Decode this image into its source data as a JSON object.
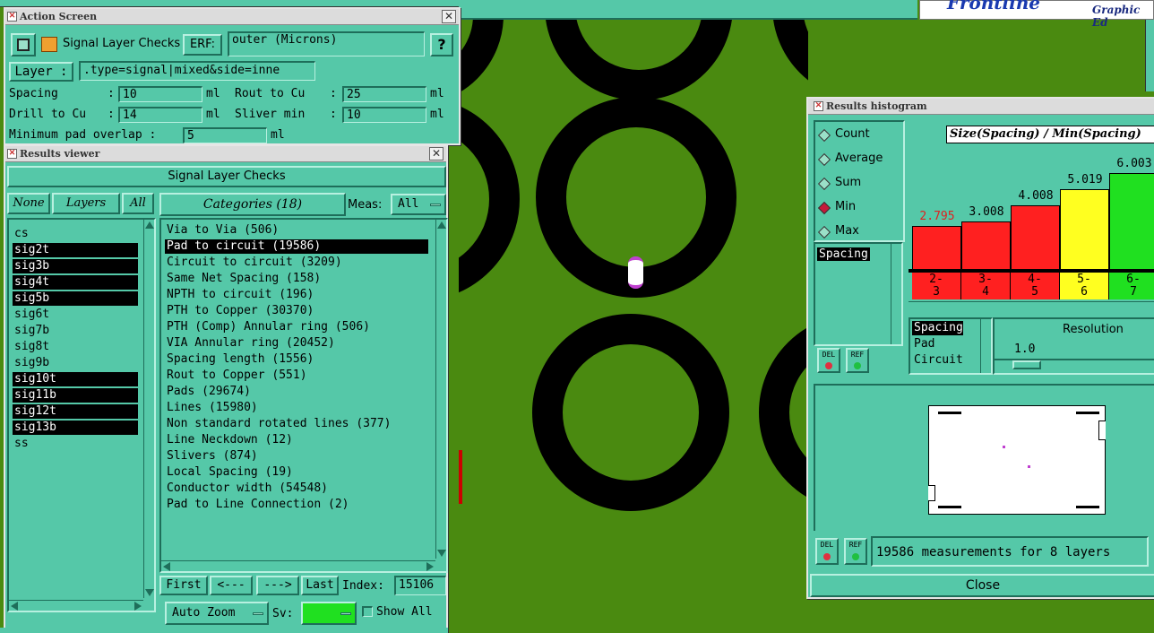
{
  "top_bar": {
    "logo_text": "Frontline",
    "subtitle": "Graphic Ed"
  },
  "action_screen": {
    "title": "Action Screen",
    "check_name": "Signal Layer Checks",
    "erf_label": "ERF:",
    "erf_value": "outer (Microns)",
    "help_label": "?",
    "layer_label": "Layer :",
    "layer_value": ".type=signal|mixed&side=inne",
    "spacing_label": "Spacing",
    "spacing_value": "10",
    "rout_label": "Rout to Cu",
    "rout_value": "25",
    "drill_label": "Drill to Cu",
    "drill_value": "14",
    "sliver_label": "Sliver min",
    "sliver_value": "10",
    "overlap_label": "Minimum pad overlap :",
    "overlap_value": "5",
    "unit": "ml",
    "colon": ":"
  },
  "results_viewer": {
    "title": "Results viewer",
    "header": "Signal Layer Checks",
    "none_btn": "None",
    "layers_btn": "Layers",
    "all_btn": "All",
    "layers": [
      {
        "name": "cs",
        "selected": false
      },
      {
        "name": "sig2t",
        "selected": true
      },
      {
        "name": "sig3b",
        "selected": true
      },
      {
        "name": "sig4t",
        "selected": true
      },
      {
        "name": "sig5b",
        "selected": true
      },
      {
        "name": "sig6t",
        "selected": false
      },
      {
        "name": "sig7b",
        "selected": false
      },
      {
        "name": "sig8t",
        "selected": false
      },
      {
        "name": "sig9b",
        "selected": false
      },
      {
        "name": "sig10t",
        "selected": true
      },
      {
        "name": "sig11b",
        "selected": true
      },
      {
        "name": "sig12t",
        "selected": true
      },
      {
        "name": "sig13b",
        "selected": true
      },
      {
        "name": "ss",
        "selected": false
      }
    ],
    "categories_btn": "Categories (18)",
    "meas_label": "Meas:",
    "meas_value": "All",
    "categories": [
      {
        "name": "Via to Via (506)",
        "selected": false
      },
      {
        "name": "Pad to circuit (19586)",
        "selected": true
      },
      {
        "name": "Circuit to circuit (3209)",
        "selected": false
      },
      {
        "name": "Same Net Spacing (158)",
        "selected": false
      },
      {
        "name": "NPTH to circuit (196)",
        "selected": false
      },
      {
        "name": "PTH to Copper (30370)",
        "selected": false
      },
      {
        "name": "PTH (Comp) Annular ring (506)",
        "selected": false
      },
      {
        "name": "VIA Annular ring (20452)",
        "selected": false
      },
      {
        "name": "Spacing length (1556)",
        "selected": false
      },
      {
        "name": "Rout to Copper (551)",
        "selected": false
      },
      {
        "name": "Pads (29674)",
        "selected": false
      },
      {
        "name": "Lines (15980)",
        "selected": false
      },
      {
        "name": "Non standard rotated lines (377)",
        "selected": false
      },
      {
        "name": "Line Neckdown (12)",
        "selected": false
      },
      {
        "name": "Slivers (874)",
        "selected": false
      },
      {
        "name": "Local Spacing (19)",
        "selected": false
      },
      {
        "name": "Conductor width (54548)",
        "selected": false
      },
      {
        "name": "Pad to Line Connection (2)",
        "selected": false
      }
    ],
    "first_btn": "First",
    "prev_btn": "<---",
    "next_btn": "--->",
    "last_btn": "Last",
    "index_label": "Index:",
    "index_value": "15106",
    "auto_zoom": "Auto Zoom",
    "sv_label": "Sv:",
    "show_all": "Show All"
  },
  "histogram": {
    "title": "Results histogram",
    "modes": [
      {
        "label": "Count",
        "on": false
      },
      {
        "label": "Average",
        "on": false
      },
      {
        "label": "Sum",
        "on": false
      },
      {
        "label": "Min",
        "on": true
      },
      {
        "label": "Max",
        "on": false
      }
    ],
    "side_list_item": "Spacing",
    "del_label": "DEL",
    "ref_label": "REF",
    "chart_title": "Size(Spacing) / Min(Spacing)",
    "bars": [
      {
        "value": "2.795",
        "color": "#ff2020",
        "label_color": "#e02020",
        "range": "2-\n3",
        "height": 0.36
      },
      {
        "value": "3.008",
        "color": "#ff2020",
        "label_color": "#000000",
        "range": "3-\n4",
        "height": 0.39
      },
      {
        "value": "4.008",
        "color": "#ff2020",
        "label_color": "#000000",
        "range": "4-\n5",
        "height": 0.52
      },
      {
        "value": "5.019",
        "color": "#ffff20",
        "label_color": "#000000",
        "range": "5-\n6",
        "height": 0.65
      },
      {
        "value": "6.003",
        "color": "#20e020",
        "label_color": "#000000",
        "range": "6-\n7",
        "height": 0.78
      }
    ],
    "measure_list": [
      "Spacing",
      "Pad",
      "Circuit"
    ],
    "resolution_label": "Resolution",
    "resolution_value": "1.0",
    "status_text": "19586 measurements for 8 layers",
    "close_label": "Close"
  }
}
